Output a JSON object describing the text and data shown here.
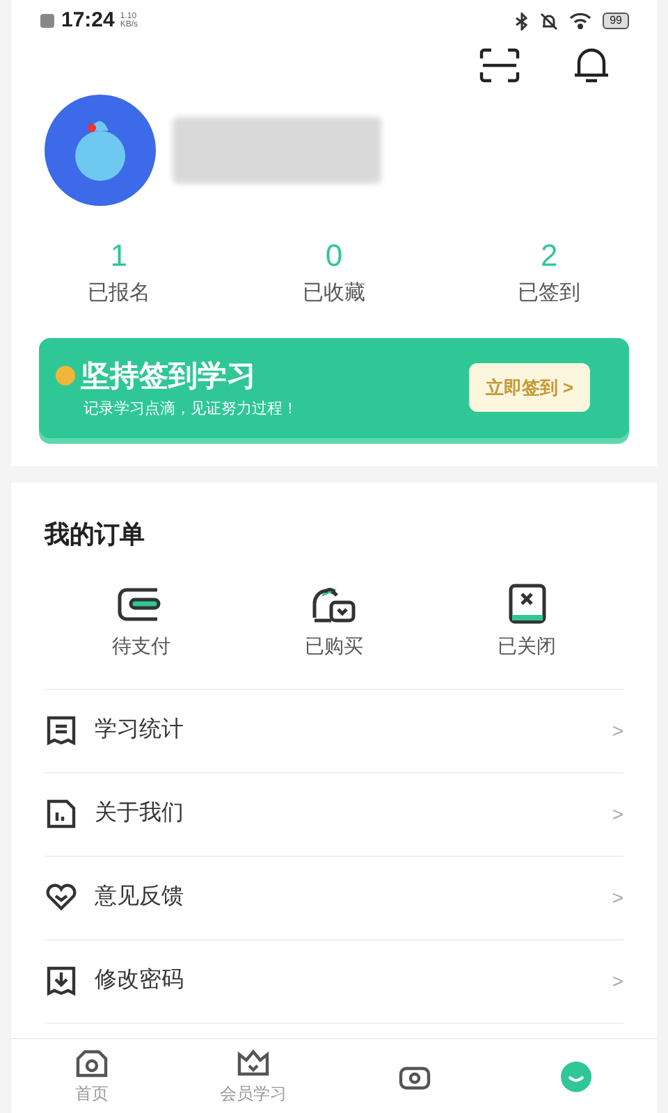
{
  "status_bar": {
    "time": "17:24",
    "speed": "1.10",
    "speed_unit": "KB/s",
    "battery": "99"
  },
  "stats": [
    {
      "value": "1",
      "label": "已报名"
    },
    {
      "value": "0",
      "label": "已收藏"
    },
    {
      "value": "2",
      "label": "已签到"
    }
  ],
  "banner": {
    "title": "坚持签到学习",
    "subtitle": "记录学习点滴，见证努力过程！",
    "button": "立即签到 >"
  },
  "orders": {
    "title": "我的订单",
    "items": [
      {
        "kind": "wallet",
        "label": "待支付"
      },
      {
        "kind": "bag",
        "label": "已购买"
      },
      {
        "kind": "closed",
        "label": "已关闭"
      }
    ]
  },
  "menu": [
    {
      "kind": "stats",
      "label": "学习统计",
      "chevron": ">"
    },
    {
      "kind": "about",
      "label": "关于我们",
      "chevron": ">"
    },
    {
      "kind": "feedback",
      "label": "意见反馈",
      "chevron": ">"
    },
    {
      "kind": "password",
      "label": "修改密码",
      "chevron": ">"
    }
  ],
  "tabbar": [
    {
      "kind": "home",
      "label": "首页",
      "selected": false
    },
    {
      "kind": "vip",
      "label": "会员学习",
      "selected": false
    },
    {
      "kind": "camera",
      "selected": false
    },
    {
      "kind": "me",
      "selected": true
    }
  ]
}
